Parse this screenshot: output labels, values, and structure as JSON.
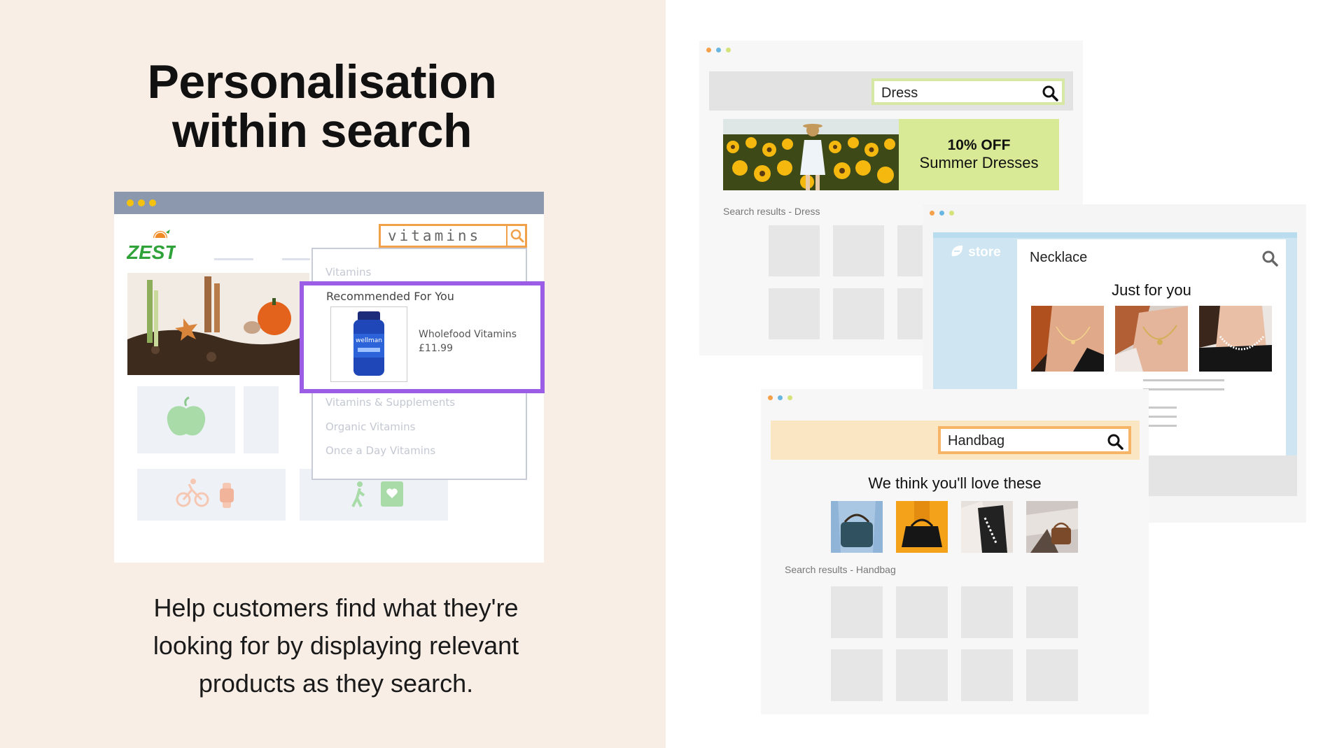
{
  "left": {
    "headline_line1": "Personalisation",
    "headline_line2": "within search",
    "subtext": "Help customers find what they're looking for by displaying relevant products as they search."
  },
  "zest_mock": {
    "logo_text": "ZEST",
    "search_value": "vitamins",
    "dropdown_top_item": "Vitamins",
    "recommended_title": "Recommended For You",
    "product_name": "Wholefood Vitamins",
    "product_price": "£11.99",
    "product_brand": "wellman",
    "dropdown_items": [
      "Vitamins & Supplements",
      "Organic Vitamins",
      "Once a Day Vitamins"
    ],
    "colors": {
      "search_border": "#f0a14a",
      "highlight": "#9b5de5",
      "bar": "#8c98ad",
      "dot": "#f3c20f"
    }
  },
  "dress_mock": {
    "search_value": "Dress",
    "promo_line1": "10% OFF",
    "promo_line2": "Summer Dresses",
    "results_label": "Search results - Dress",
    "colors": {
      "search_border": "#d7e8a4",
      "promo_bg": "#d8ea95"
    }
  },
  "necklace_mock": {
    "store_label": "store",
    "search_value": "Necklace",
    "title": "Just for you",
    "colors": {
      "panel_bg": "#cfe6f2"
    }
  },
  "handbag_mock": {
    "search_value": "Handbag",
    "title": "We think you'll love these",
    "results_label": "Search results - Handbag",
    "colors": {
      "search_border": "#f5b466",
      "bar_bg": "#fbe6c4"
    }
  },
  "icons": [
    "search-icon",
    "apple-icon",
    "bicycle-icon",
    "watch-icon",
    "hiker-icon",
    "heart-book-icon",
    "leaf-e-icon"
  ]
}
